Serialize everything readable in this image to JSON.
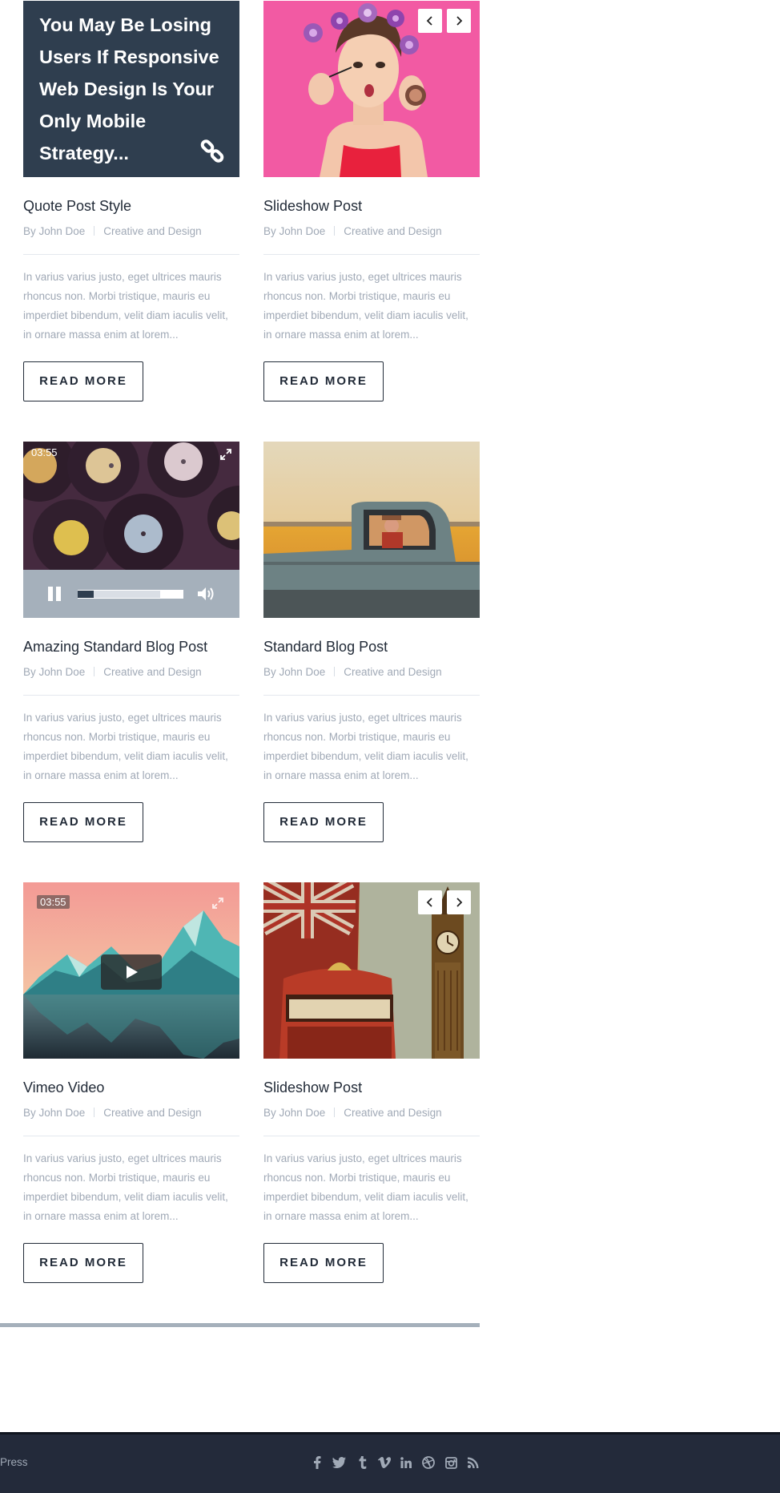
{
  "posts": [
    {
      "kind": "quote",
      "quote": "You May Be Losing Users If Responsive Web Design Is Your Only Mobile Strategy...",
      "title": "Quote Post Style",
      "author": "By John Doe",
      "category": "Creative and Design",
      "excerpt": "In varius varius justo, eget ultrices mauris rhoncus non. Morbi tristique, mauris eu imperdiet bibendum, velit diam iaculis velit, in ornare massa enim at lorem...",
      "read_more": "READ MORE"
    },
    {
      "kind": "slideshow",
      "title": "Slideshow Post",
      "author": "By John Doe",
      "category": "Creative and Design",
      "excerpt": "In varius varius justo, eget ultrices mauris rhoncus non. Morbi tristique, mauris eu imperdiet bibendum, velit diam iaculis velit, in ornare massa enim at lorem...",
      "read_more": "READ MORE"
    },
    {
      "kind": "audio-video",
      "time": "03:55",
      "progress": 0.15,
      "buffered": 0.78,
      "title": "Amazing Standard Blog Post",
      "author": "By John Doe",
      "category": "Creative and Design",
      "excerpt": "In varius varius justo, eget ultrices mauris rhoncus non. Morbi tristique, mauris eu imperdiet bibendum, velit diam iaculis velit, in ornare massa enim at lorem...",
      "read_more": "READ MORE"
    },
    {
      "kind": "standard",
      "title": "Standard Blog Post",
      "author": "By John Doe",
      "category": "Creative and Design",
      "excerpt": "In varius varius justo, eget ultrices mauris rhoncus non. Morbi tristique, mauris eu imperdiet bibendum, velit diam iaculis velit, in ornare massa enim at lorem...",
      "read_more": "READ MORE"
    },
    {
      "kind": "vimeo",
      "time": "03:55",
      "title": "Vimeo Video",
      "author": "By John Doe",
      "category": "Creative and Design",
      "excerpt": "In varius varius justo, eget ultrices mauris rhoncus non. Morbi tristique, mauris eu imperdiet bibendum, velit diam iaculis velit, in ornare massa enim at lorem...",
      "read_more": "READ MORE"
    },
    {
      "kind": "slideshow",
      "title": "Slideshow Post",
      "author": "By John Doe",
      "category": "Creative and Design",
      "excerpt": "In varius varius justo, eget ultrices mauris rhoncus non. Morbi tristique, mauris eu imperdiet bibendum, velit diam iaculis velit, in ornare massa enim at lorem...",
      "read_more": "READ MORE"
    }
  ],
  "footer": {
    "text": "Press",
    "social_icons": [
      "facebook-icon",
      "twitter-icon",
      "tumblr-icon",
      "vimeo-icon",
      "linkedin-icon",
      "dribbble-icon",
      "instagram-icon",
      "rss-icon"
    ]
  },
  "colors": {
    "dark": "#2f3e4f",
    "text": "#222b38",
    "muted": "#a0a9b6",
    "footer_bg": "#232a3a",
    "controls_bg": "#a5b0bb"
  }
}
